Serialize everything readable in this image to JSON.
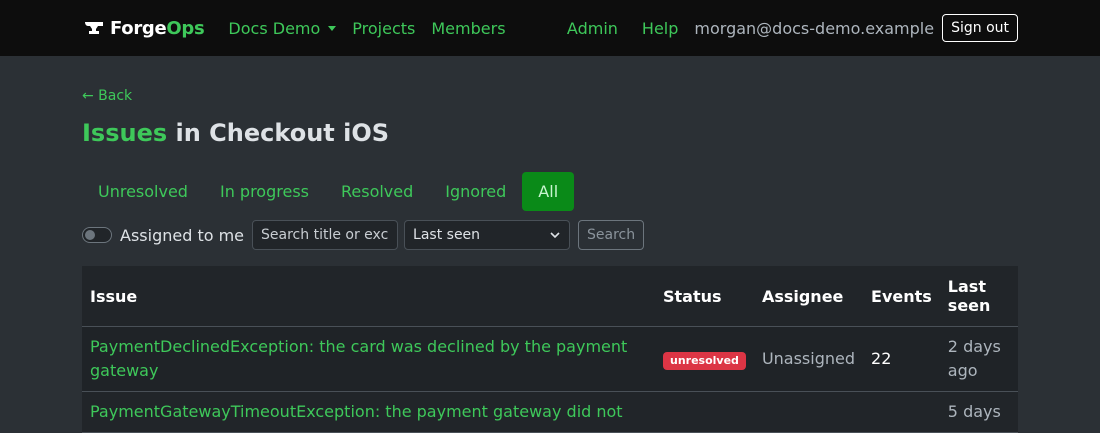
{
  "nav": {
    "brand_a": "Forge",
    "brand_b": "Ops",
    "org": "Docs Demo",
    "projects": "Projects",
    "members": "Members",
    "admin": "Admin",
    "help": "Help",
    "user_email": "morgan@docs-demo.example",
    "sign_out": "Sign out"
  },
  "page": {
    "back": "← Back",
    "title_link": "Issues",
    "title_rest": " in Checkout iOS"
  },
  "tabs": [
    {
      "label": "Unresolved",
      "active": false
    },
    {
      "label": "In progress",
      "active": false
    },
    {
      "label": "Resolved",
      "active": false
    },
    {
      "label": "Ignored",
      "active": false
    },
    {
      "label": "All",
      "active": true
    }
  ],
  "filters": {
    "assigned_label": "Assigned to me",
    "search_placeholder": "Search title or exce",
    "sort_value": "Last seen",
    "search_button": "Search"
  },
  "table": {
    "headers": [
      "Issue",
      "Status",
      "Assignee",
      "Events",
      "Last seen"
    ],
    "rows": [
      {
        "issue": "PaymentDeclinedException: the card was declined by the payment gateway",
        "status": "unresolved",
        "assignee": "Unassigned",
        "events": "22",
        "last_seen": "2 days ago"
      },
      {
        "issue": "PaymentGatewayTimeoutException: the payment gateway did not",
        "status": "",
        "assignee": "",
        "events": "",
        "last_seen": "5 days"
      }
    ]
  },
  "colors": {
    "accent": "#3ec85a",
    "active_tab": "#0a8a18",
    "badge": "#dc3545",
    "navbar": "#0d0d0d",
    "background": "#2b3035"
  }
}
